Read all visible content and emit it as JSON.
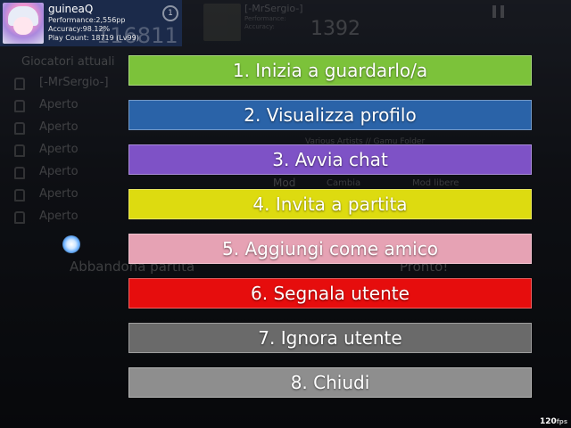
{
  "user_card": {
    "name": "guineaQ",
    "performance": "Performance:2,556pp",
    "accuracy": "Accuracy:98.12%",
    "play_count": "Play Count: 18719 (Lv99)",
    "score": "116811",
    "rank": "1"
  },
  "host_card": {
    "name": "[-MrSergio-]",
    "performance": "Performance:",
    "accuracy": "Accuracy:",
    "score": "1392"
  },
  "lobby": {
    "players_header": "Giocatori attuali",
    "slots": [
      "[-MrSergio-]",
      "Aperto",
      "Aperto",
      "Aperto",
      "Aperto",
      "Aperto",
      "Aperto"
    ],
    "leave_label": "Abbandona partita",
    "ready_label": "Pronto!",
    "mod_label": "Mod",
    "change_label": "Cambia",
    "freemod_label": "Mod libere",
    "song_sub": "Various Artists // Gamu Folder"
  },
  "menu": {
    "items": [
      {
        "label": "1. Inizia a guardarlo/a",
        "color": "#7cc23a"
      },
      {
        "label": "2. Visualizza profilo",
        "color": "#2a63a8"
      },
      {
        "label": "3. Avvia chat",
        "color": "#7e52c6"
      },
      {
        "label": "4. Invita a partita",
        "color": "#dddb10"
      },
      {
        "label": "5. Aggiungi come amico",
        "color": "#e6a2b4"
      },
      {
        "label": "6. Segnala utente",
        "color": "#e60d0d"
      },
      {
        "label": "7. Ignora utente",
        "color": "#6a6a6a"
      },
      {
        "label": "8. Chiudi",
        "color": "#8e8e8e"
      }
    ]
  },
  "fps": {
    "value": "120",
    "unit": "fps"
  }
}
